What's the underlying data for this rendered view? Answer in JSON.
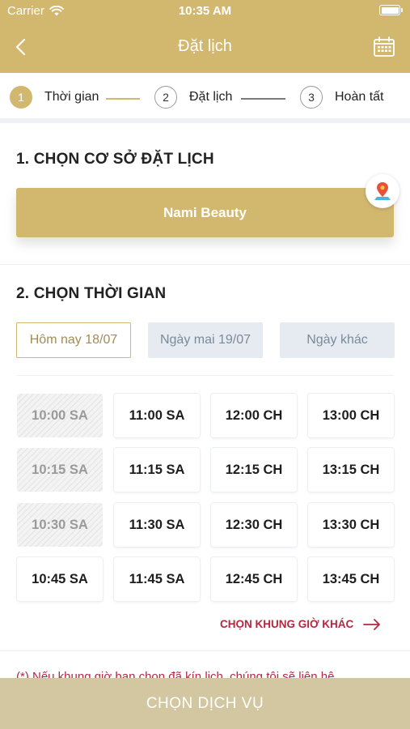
{
  "status_bar": {
    "carrier": "Carrier",
    "time": "10:35 AM"
  },
  "nav": {
    "title": "Đặt lịch",
    "back_icon": "chevron-left-icon",
    "calendar_icon": "calendar-icon"
  },
  "stepper": {
    "steps": [
      {
        "number": "1",
        "label": "Thời gian",
        "active": true
      },
      {
        "number": "2",
        "label": "Đặt lịch",
        "active": false
      },
      {
        "number": "3",
        "label": "Hoàn tất",
        "active": false
      }
    ]
  },
  "branch_section": {
    "title": "1. CHỌN CƠ SỞ ĐẶT LỊCH",
    "branch_name": "Nami Beauty",
    "pin_icon": "map-pin-icon"
  },
  "time_section": {
    "title": "2. CHỌN THỜI GIAN",
    "day_tabs": [
      {
        "label": "Hôm nay 18/07",
        "selected": true
      },
      {
        "label": "Ngày mai 19/07",
        "selected": false
      },
      {
        "label": "Ngày khác",
        "selected": false
      }
    ],
    "slots": [
      [
        {
          "label": "10:00 SA",
          "disabled": true
        },
        {
          "label": "11:00 SA",
          "disabled": false
        },
        {
          "label": "12:00 CH",
          "disabled": false
        },
        {
          "label": "13:00 CH",
          "disabled": false
        }
      ],
      [
        {
          "label": "10:15 SA",
          "disabled": true
        },
        {
          "label": "11:15 SA",
          "disabled": false
        },
        {
          "label": "12:15 CH",
          "disabled": false
        },
        {
          "label": "13:15 CH",
          "disabled": false
        }
      ],
      [
        {
          "label": "10:30 SA",
          "disabled": true
        },
        {
          "label": "11:30 SA",
          "disabled": false
        },
        {
          "label": "12:30 CH",
          "disabled": false
        },
        {
          "label": "13:30 CH",
          "disabled": false
        }
      ],
      [
        {
          "label": "10:45 SA",
          "disabled": false
        },
        {
          "label": "11:45 SA",
          "disabled": false
        },
        {
          "label": "12:45 CH",
          "disabled": false
        },
        {
          "label": "13:45 CH",
          "disabled": false
        }
      ]
    ],
    "more_label": "CHỌN KHUNG GIỜ KHÁC",
    "note": "(*) Nếu khung giờ bạn chọn đã kín lịch, chúng tôi sẽ liên hệ"
  },
  "bottom_button": {
    "label": "CHỌN DỊCH VỤ"
  },
  "colors": {
    "accent": "#d2b86f",
    "danger": "#b5283f",
    "tab_bg": "#e6ebf2",
    "bottom_bar": "#d2c7a0"
  }
}
